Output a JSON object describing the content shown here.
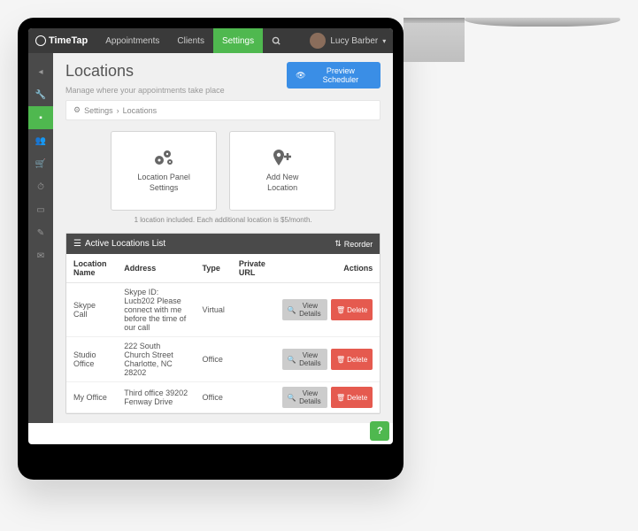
{
  "brand": "TimeTap",
  "nav": {
    "items": [
      "Appointments",
      "Clients",
      "Settings"
    ],
    "active": 2
  },
  "user": {
    "name": "Lucy Barber"
  },
  "page": {
    "title": "Locations",
    "subtitle": "Manage where your appointments take place"
  },
  "preview_btn": "Preview Scheduler",
  "breadcrumb": [
    "Settings",
    "Locations"
  ],
  "cards": {
    "settings": "Location Panel\nSettings",
    "add": "Add New\nLocation"
  },
  "price_note": "1 location included. Each additional location is $5/month.",
  "panel": {
    "title": "Active Locations List",
    "reorder": "Reorder"
  },
  "table": {
    "headers": [
      "Location Name",
      "Address",
      "Type",
      "Private URL",
      "Actions"
    ],
    "rows": [
      {
        "name": "Skype Call",
        "address": "Skype ID: Lucb202 Please connect with me before the time of our call",
        "type": "Virtual",
        "url": ""
      },
      {
        "name": "Studio Office",
        "address": "222 South Church Street Charlotte, NC 28202",
        "type": "Office",
        "url": ""
      },
      {
        "name": "My Office",
        "address": "Third office 39202 Fenway Drive",
        "type": "Office",
        "url": ""
      }
    ]
  },
  "buttons": {
    "view": "View Details",
    "delete": "Delete"
  }
}
